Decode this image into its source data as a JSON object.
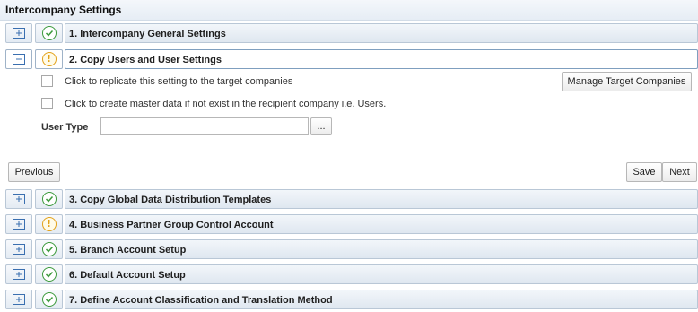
{
  "header": {
    "title": "Intercompany Settings"
  },
  "steps": [
    {
      "label": "1. Intercompany General Settings",
      "status": "complete"
    },
    {
      "label": "2. Copy Users and User Settings",
      "status": "warning"
    },
    {
      "label": "3. Copy Global Data Distribution Templates",
      "status": "complete"
    },
    {
      "label": "4. Business Partner Group Control Account",
      "status": "warning"
    },
    {
      "label": "5. Branch Account Setup",
      "status": "complete"
    },
    {
      "label": "6. Default Account Setup",
      "status": "complete"
    },
    {
      "label": "7. Define Account Classification and Translation Method",
      "status": "complete"
    }
  ],
  "panel": {
    "replicate_label": "Click to replicate this setting to the target companies",
    "create_master_label": "Click to create master data if not exist in the recipient company i.e. Users.",
    "manage_button": "Manage Target Companies",
    "user_type_label": "User Type",
    "user_type_value": "",
    "browse_button": "..."
  },
  "footer": {
    "previous": "Previous",
    "save": "Save",
    "next": "Next"
  },
  "colors": {
    "complete": "#3c9a3c",
    "warning": "#e3a21a",
    "accent_border": "#7f9fbf"
  },
  "icons": {
    "expand": "expand-step-icon",
    "complete": "check-circle-icon",
    "warning": "warning-circle-icon"
  }
}
